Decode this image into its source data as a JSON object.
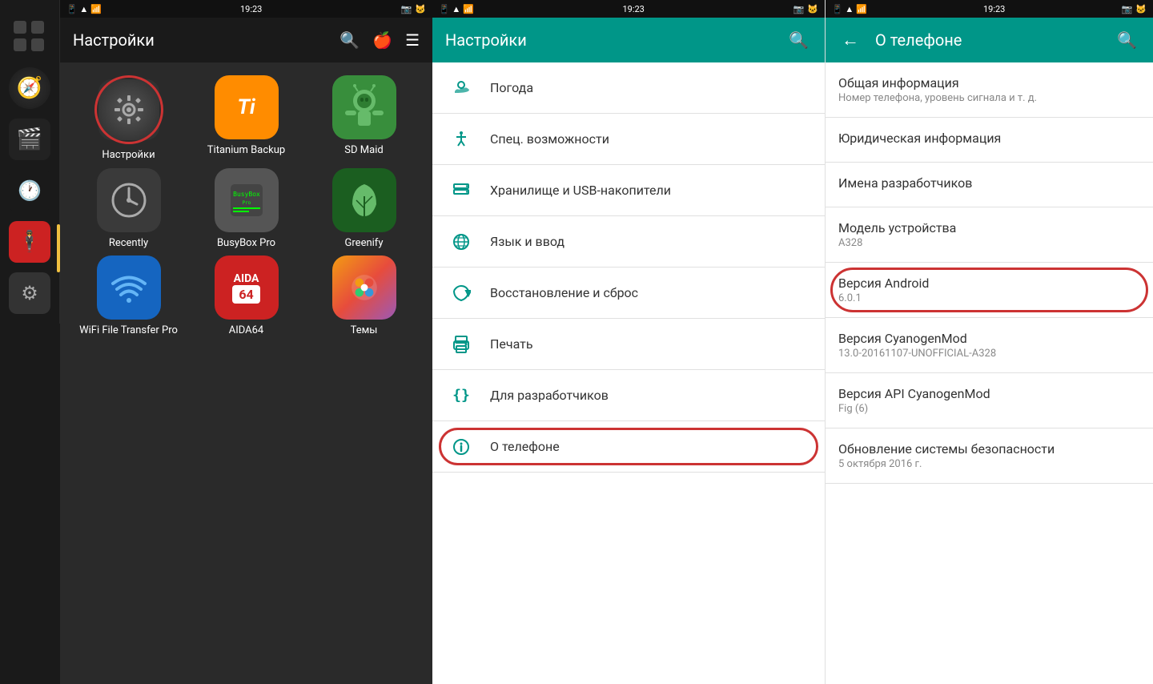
{
  "statusBar": {
    "leftTime": "19:23",
    "middleTime": "19:23",
    "rightTime": "19:23"
  },
  "leftPanel": {
    "icons": [
      {
        "name": "grid-icon",
        "symbol": "⊞"
      },
      {
        "name": "compass-icon",
        "symbol": "🧭"
      },
      {
        "name": "movie-icon",
        "symbol": "🎬"
      },
      {
        "name": "clock-icon",
        "symbol": "🕐"
      },
      {
        "name": "suit-icon",
        "symbol": "🕴"
      },
      {
        "name": "settings-gear-icon",
        "symbol": "⚙"
      }
    ]
  },
  "middlePanel": {
    "title": "Настройки",
    "apps": [
      {
        "id": "nastroyki",
        "label": "Настройки",
        "selected": true
      },
      {
        "id": "titanium",
        "label": "Titanium Backup"
      },
      {
        "id": "sdmaid",
        "label": "SD Maid"
      },
      {
        "id": "recently",
        "label": "Recently"
      },
      {
        "id": "busybox",
        "label": "BusyBox Pro"
      },
      {
        "id": "greenify",
        "label": "Greenify"
      },
      {
        "id": "wifi",
        "label": "WiFi File Transfer Pro"
      },
      {
        "id": "aida64",
        "label": "AIDA64"
      },
      {
        "id": "themes",
        "label": "Темы"
      }
    ]
  },
  "settingsPanel": {
    "title": "Настройки",
    "items": [
      {
        "id": "weather",
        "icon": "☁",
        "label": "Погода"
      },
      {
        "id": "accessibility",
        "icon": "♿",
        "label": "Спец. возможности"
      },
      {
        "id": "storage",
        "icon": "▤",
        "label": "Хранилище и USB-накопители"
      },
      {
        "id": "language",
        "icon": "🌐",
        "label": "Язык и ввод"
      },
      {
        "id": "restore",
        "icon": "☁",
        "label": "Восстановление и сброс"
      },
      {
        "id": "print",
        "icon": "🖨",
        "label": "Печать"
      },
      {
        "id": "developer",
        "icon": "{}",
        "label": "Для разработчиков"
      },
      {
        "id": "about",
        "icon": "ℹ",
        "label": "О телефоне",
        "highlighted": true
      }
    ]
  },
  "aboutPanel": {
    "title": "О телефоне",
    "backLabel": "←",
    "items": [
      {
        "id": "general",
        "title": "Общая информация",
        "subtitle": "Номер телефона, уровень сигнала и т. д."
      },
      {
        "id": "legal",
        "title": "Юридическая информация",
        "subtitle": ""
      },
      {
        "id": "devnames",
        "title": "Имена разработчиков",
        "subtitle": ""
      },
      {
        "id": "model",
        "title": "Модель устройства",
        "subtitle": "A328"
      },
      {
        "id": "androidversion",
        "title": "Версия Android",
        "subtitle": "6.0.1",
        "highlighted": true
      },
      {
        "id": "cyanogenmod",
        "title": "Версия CyanogenMod",
        "subtitle": "13.0-20161107-UNOFFICIAL-A328"
      },
      {
        "id": "cyanogenapi",
        "title": "Версия API CyanogenMod",
        "subtitle": "Fig (6)"
      },
      {
        "id": "security",
        "title": "Обновление системы безопасности",
        "subtitle": "5 октября 2016 г."
      }
    ]
  }
}
